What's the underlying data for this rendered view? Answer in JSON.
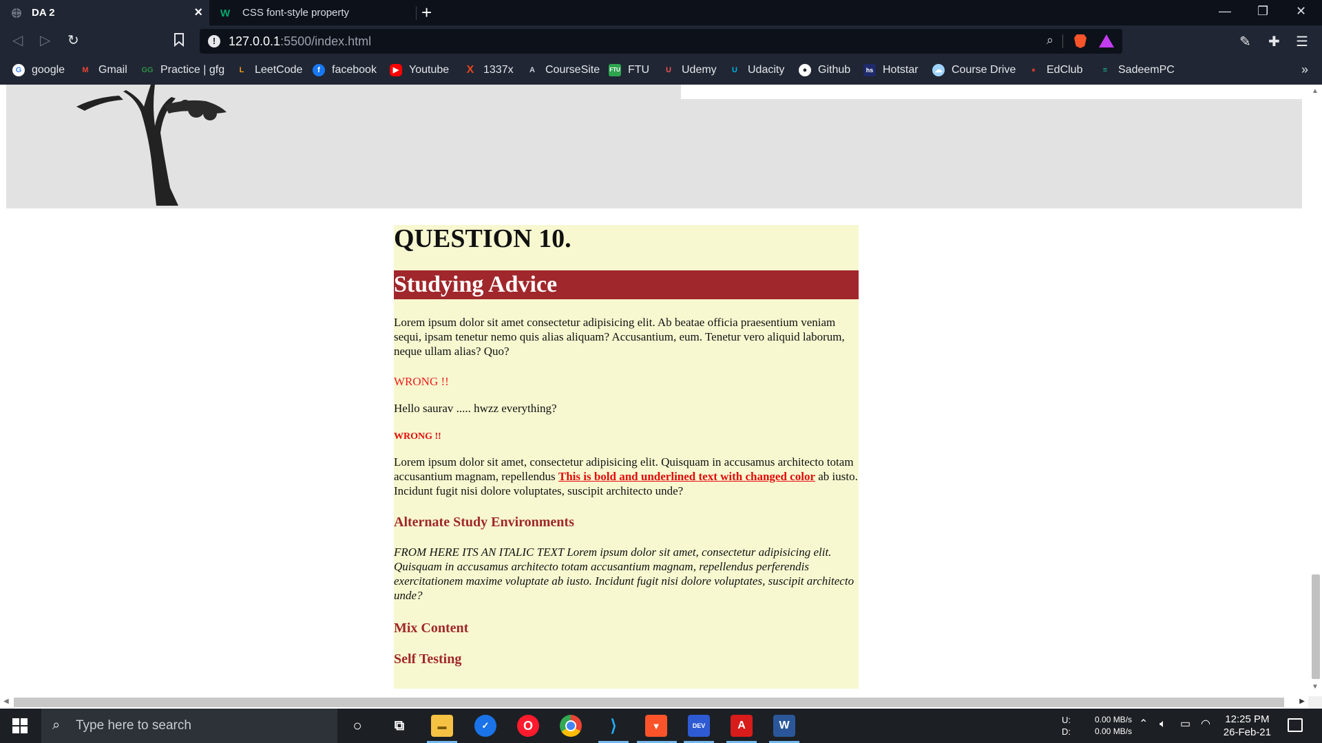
{
  "browser": {
    "tabs": [
      {
        "title": "DA 2",
        "active": true
      },
      {
        "title": "CSS font-style property",
        "active": false
      }
    ],
    "url_host": "127.0.0.1",
    "url_rest": ":5500/index.html",
    "bookmarks": [
      {
        "label": "google",
        "icon": "google-icon",
        "color": "#4285f4"
      },
      {
        "label": "Gmail",
        "icon": "gmail-icon",
        "color": "#ea4335"
      },
      {
        "label": "Practice | gfg",
        "icon": "gfg-icon",
        "color": "#2f8d46"
      },
      {
        "label": "LeetCode",
        "icon": "leetcode-icon",
        "color": "#f89f1b"
      },
      {
        "label": "facebook",
        "icon": "facebook-icon",
        "color": "#1877f2"
      },
      {
        "label": "Youtube",
        "icon": "youtube-icon",
        "color": "#ff0000"
      },
      {
        "label": "1337x",
        "icon": "1337x-icon",
        "color": "#e9451c"
      },
      {
        "label": "CourseSite",
        "icon": "coursesite-icon",
        "color": "#8a8f99"
      },
      {
        "label": "FTU",
        "icon": "ftu-icon",
        "color": "#2ea44f"
      },
      {
        "label": "Udemy",
        "icon": "udemy-icon",
        "color": "#ec5252"
      },
      {
        "label": "Udacity",
        "icon": "udacity-icon",
        "color": "#02b3e4"
      },
      {
        "label": "Github",
        "icon": "github-icon",
        "color": "#ffffff"
      },
      {
        "label": "Hotstar",
        "icon": "hotstar-icon",
        "color": "#1f2a6b"
      },
      {
        "label": "Course Drive",
        "icon": "course-drive-icon",
        "color": "#9fd3ff"
      },
      {
        "label": "EdClub",
        "icon": "edclub-icon",
        "color": "#c0392b"
      },
      {
        "label": "SadeemPC",
        "icon": "sadeempc-icon",
        "color": "#1abc9c"
      }
    ]
  },
  "page": {
    "question_title": "QUESTION 10.",
    "banner_heading": "Studying Advice",
    "para1": "Lorem ipsum dolor sit amet consectetur adipisicing elit. Ab beatae officia praesentium veniam sequi, ipsam tenetur nemo quis alias aliquam? Accusantium, eum. Tenetur vero aliquid laborum, neque ullam alias? Quo?",
    "wrong1": "WRONG !!",
    "hello": "Hello saurav ..... hwzz everything?",
    "wrong2": "WRONG !!",
    "para2_start": "Lorem ipsum dolor sit amet, consectetur adipisicing elit. Quisquam in accusamus architecto totam accusantium magnam, repellendus ",
    "para2_bold": "This is bold and underlined text with changed color",
    "para2_end": " ab iusto. Incidunt fugit nisi dolore voluptates, suscipit architecto unde?",
    "heading_alt": "Alternate Study Environments",
    "italic_para": "FROM HERE ITS AN ITALIC TEXT Lorem ipsum dolor sit amet, consectetur adipisicing elit. Quisquam in accusamus architecto totam accusantium magnam, repellendus perferendis exercitationem maxime voluptate ab iusto. Incidunt fugit nisi dolore voluptates, suscipit architecto unde?",
    "heading_mix": "Mix Content",
    "heading_self": "Self Testing"
  },
  "taskbar": {
    "search_placeholder": "Type here to search",
    "net_u_label": "U:",
    "net_d_label": "D:",
    "net_u_value": "0.00 MB/s",
    "net_d_value": "0.00 MB/s",
    "time": "12:25 PM",
    "date": "26-Feb-21"
  }
}
